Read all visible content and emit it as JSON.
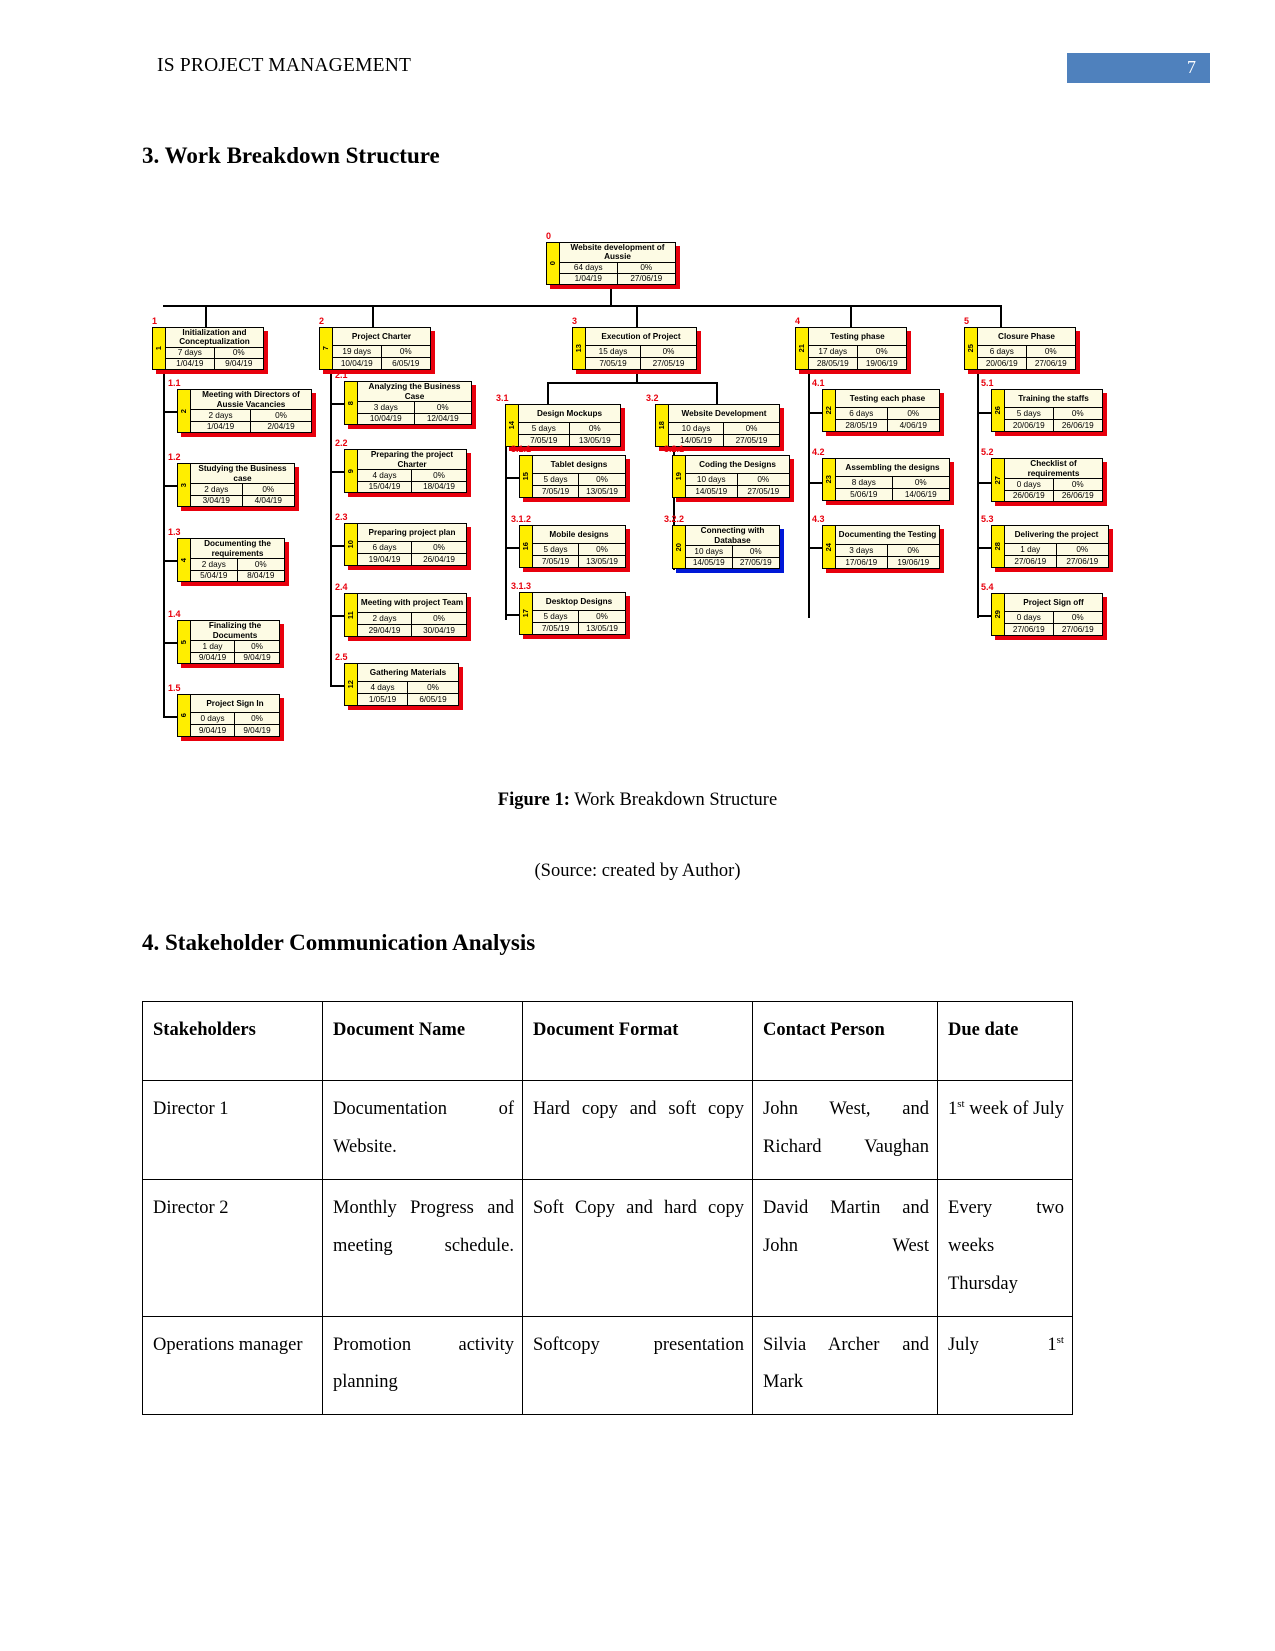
{
  "header": {
    "title": "IS PROJECT MANAGEMENT",
    "page_number": "7",
    "accent_color": "#4f81bd"
  },
  "sections": {
    "wbs_heading": "3. Work Breakdown Structure",
    "stakeholder_heading": "4. Stakeholder Communication Analysis"
  },
  "figure": {
    "caption_label": "Figure 1:",
    "caption_text": " Work Breakdown Structure",
    "source": "(Source: created by Author)"
  },
  "wbs": {
    "nodes": [
      {
        "wbs": "0",
        "id": "0",
        "title": "Website development of Aussie",
        "duration": "64 days",
        "progress": "0%",
        "start": "1/04/19",
        "finish": "27/06/19"
      },
      {
        "wbs": "1",
        "id": "1",
        "title": "Initialization and Conceptualization",
        "duration": "7 days",
        "progress": "0%",
        "start": "1/04/19",
        "finish": "9/04/19"
      },
      {
        "wbs": "1.1",
        "id": "2",
        "title": "Meeting with Directors of Aussie Vacancies",
        "duration": "2 days",
        "progress": "0%",
        "start": "1/04/19",
        "finish": "2/04/19"
      },
      {
        "wbs": "1.2",
        "id": "3",
        "title": "Studying the Business case",
        "duration": "2 days",
        "progress": "0%",
        "start": "3/04/19",
        "finish": "4/04/19"
      },
      {
        "wbs": "1.3",
        "id": "4",
        "title": "Documenting the requirements",
        "duration": "2 days",
        "progress": "0%",
        "start": "5/04/19",
        "finish": "8/04/19"
      },
      {
        "wbs": "1.4",
        "id": "5",
        "title": "Finalizing the Documents",
        "duration": "1 day",
        "progress": "0%",
        "start": "9/04/19",
        "finish": "9/04/19"
      },
      {
        "wbs": "1.5",
        "id": "6",
        "title": "Project Sign In",
        "duration": "0 days",
        "progress": "0%",
        "start": "9/04/19",
        "finish": "9/04/19"
      },
      {
        "wbs": "2",
        "id": "7",
        "title": "Project Charter",
        "duration": "19 days",
        "progress": "0%",
        "start": "10/04/19",
        "finish": "6/05/19"
      },
      {
        "wbs": "2.1",
        "id": "8",
        "title": "Analyzing the Business Case",
        "duration": "3 days",
        "progress": "0%",
        "start": "10/04/19",
        "finish": "12/04/19"
      },
      {
        "wbs": "2.2",
        "id": "9",
        "title": "Preparing the project Charter",
        "duration": "4 days",
        "progress": "0%",
        "start": "15/04/19",
        "finish": "18/04/19"
      },
      {
        "wbs": "2.3",
        "id": "10",
        "title": "Preparing project plan",
        "duration": "6 days",
        "progress": "0%",
        "start": "19/04/19",
        "finish": "26/04/19"
      },
      {
        "wbs": "2.4",
        "id": "11",
        "title": "Meeting with project Team",
        "duration": "2 days",
        "progress": "0%",
        "start": "29/04/19",
        "finish": "30/04/19"
      },
      {
        "wbs": "2.5",
        "id": "12",
        "title": "Gathering Materials",
        "duration": "4 days",
        "progress": "0%",
        "start": "1/05/19",
        "finish": "6/05/19"
      },
      {
        "wbs": "3",
        "id": "13",
        "title": "Execution of Project",
        "duration": "15 days",
        "progress": "0%",
        "start": "7/05/19",
        "finish": "27/05/19"
      },
      {
        "wbs": "3.1",
        "id": "14",
        "title": "Design Mockups",
        "duration": "5 days",
        "progress": "0%",
        "start": "7/05/19",
        "finish": "13/05/19"
      },
      {
        "wbs": "3.1.1",
        "id": "15",
        "title": "Tablet designs",
        "duration": "5 days",
        "progress": "0%",
        "start": "7/05/19",
        "finish": "13/05/19"
      },
      {
        "wbs": "3.1.2",
        "id": "16",
        "title": "Mobile designs",
        "duration": "5 days",
        "progress": "0%",
        "start": "7/05/19",
        "finish": "13/05/19"
      },
      {
        "wbs": "3.1.3",
        "id": "17",
        "title": "Desktop Designs",
        "duration": "5 days",
        "progress": "0%",
        "start": "7/05/19",
        "finish": "13/05/19"
      },
      {
        "wbs": "3.2",
        "id": "18",
        "title": "Website Development",
        "duration": "10 days",
        "progress": "0%",
        "start": "14/05/19",
        "finish": "27/05/19"
      },
      {
        "wbs": "3.2.1",
        "id": "19",
        "title": "Coding the Designs",
        "duration": "10 days",
        "progress": "0%",
        "start": "14/05/19",
        "finish": "27/05/19"
      },
      {
        "wbs": "3.2.2",
        "id": "20",
        "title": "Connecting with Database",
        "duration": "10 days",
        "progress": "0%",
        "start": "14/05/19",
        "finish": "27/05/19"
      },
      {
        "wbs": "4",
        "id": "21",
        "title": "Testing phase",
        "duration": "17 days",
        "progress": "0%",
        "start": "28/05/19",
        "finish": "19/06/19"
      },
      {
        "wbs": "4.1",
        "id": "22",
        "title": "Testing each phase",
        "duration": "6 days",
        "progress": "0%",
        "start": "28/05/19",
        "finish": "4/06/19"
      },
      {
        "wbs": "4.2",
        "id": "23",
        "title": "Assembling the designs",
        "duration": "8 days",
        "progress": "0%",
        "start": "5/06/19",
        "finish": "14/06/19"
      },
      {
        "wbs": "4.3",
        "id": "24",
        "title": "Documenting the Testing",
        "duration": "3 days",
        "progress": "0%",
        "start": "17/06/19",
        "finish": "19/06/19"
      },
      {
        "wbs": "5",
        "id": "25",
        "title": "Closure Phase",
        "duration": "6 days",
        "progress": "0%",
        "start": "20/06/19",
        "finish": "27/06/19"
      },
      {
        "wbs": "5.1",
        "id": "26",
        "title": "Training the staffs",
        "duration": "5 days",
        "progress": "0%",
        "start": "20/06/19",
        "finish": "26/06/19"
      },
      {
        "wbs": "5.2",
        "id": "27",
        "title": "Checklist of requirements",
        "duration": "0 days",
        "progress": "0%",
        "start": "26/06/19",
        "finish": "26/06/19"
      },
      {
        "wbs": "5.3",
        "id": "28",
        "title": "Delivering the project",
        "duration": "1 day",
        "progress": "0%",
        "start": "27/06/19",
        "finish": "27/06/19"
      },
      {
        "wbs": "5.4",
        "id": "29",
        "title": "Project Sign off",
        "duration": "0 days",
        "progress": "0%",
        "start": "27/06/19",
        "finish": "27/06/19"
      }
    ]
  },
  "stakeholder_table": {
    "columns": [
      "Stakeholders",
      "Document Name",
      "Document Format",
      "Contact Person",
      "Due date"
    ],
    "rows": [
      {
        "stakeholder": "Director 1",
        "document_name": "Documentation of Website.",
        "document_format": "Hard copy and soft copy",
        "contact_person": "John West, and Richard Vaughan",
        "due_date_main": "1",
        "due_date_sup": "st",
        "due_date_rest": " week of July"
      },
      {
        "stakeholder": "Director 2",
        "document_name": "Monthly Progress and meeting schedule.",
        "document_format": "Soft Copy and hard copy",
        "contact_person": "David Martin and John West",
        "due_date_main": "Every two weeks Thursday",
        "due_date_sup": "",
        "due_date_rest": ""
      },
      {
        "stakeholder": "Operations manager",
        "document_name": "Promotion activity planning",
        "document_format": "Softcopy presentation",
        "contact_person": "Silvia Archer and Mark",
        "due_date_main": "July 1",
        "due_date_sup": "st",
        "due_date_rest": ""
      }
    ]
  }
}
